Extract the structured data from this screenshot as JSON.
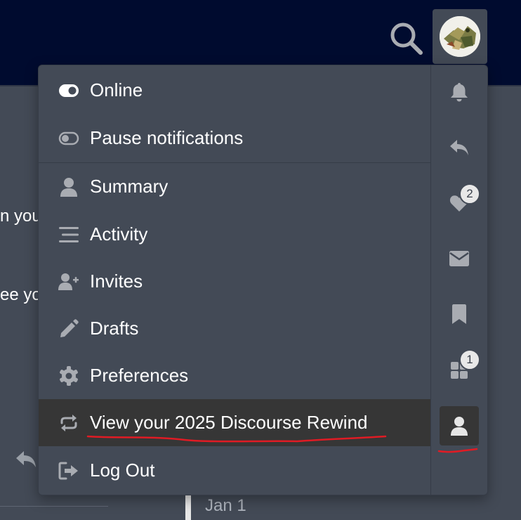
{
  "background": {
    "snippet_1": "n you",
    "snippet_2": "ee yo",
    "timeline_date": "Jan 1"
  },
  "header": {
    "search_icon": "search-icon",
    "avatar": "user-avatar"
  },
  "user_menu": {
    "status_items": [
      {
        "label": "Online",
        "icon": "toggle-on-icon"
      },
      {
        "label": "Pause notifications",
        "icon": "toggle-off-icon"
      }
    ],
    "profile_items": [
      {
        "label": "Summary",
        "icon": "user-icon"
      },
      {
        "label": "Activity",
        "icon": "stream-icon"
      },
      {
        "label": "Invites",
        "icon": "user-plus-icon"
      },
      {
        "label": "Drafts",
        "icon": "pencil-icon"
      },
      {
        "label": "Preferences",
        "icon": "gear-icon"
      },
      {
        "label": "View your 2025 Discourse Rewind",
        "icon": "repeat-icon",
        "active": true
      },
      {
        "label": "Log Out",
        "icon": "sign-out-icon"
      }
    ]
  },
  "rail": [
    {
      "name": "notifications",
      "icon": "bell-icon"
    },
    {
      "name": "replies",
      "icon": "reply-icon"
    },
    {
      "name": "likes",
      "icon": "heart-icon",
      "badge": "2"
    },
    {
      "name": "messages",
      "icon": "envelope-icon"
    },
    {
      "name": "bookmarks",
      "icon": "bookmark-icon"
    },
    {
      "name": "other",
      "icon": "grid-icon",
      "badge": "1"
    },
    {
      "name": "profile",
      "icon": "user-icon",
      "active": true
    }
  ],
  "colors": {
    "header_bg": "#000b2f",
    "menu_bg": "#434a56",
    "active_bg": "#363636",
    "icon_gray": "#a9acb2",
    "annotation_red": "#e01b24"
  }
}
